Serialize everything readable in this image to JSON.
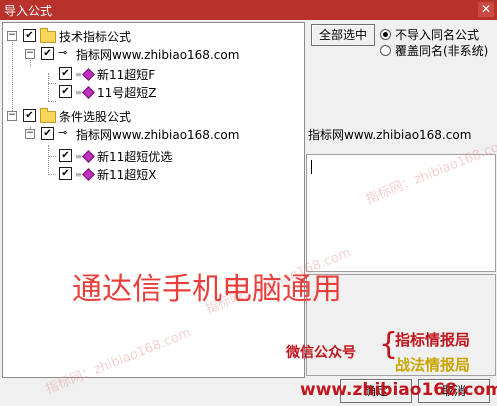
{
  "window": {
    "title": "导入公式",
    "close_glyph": "✕"
  },
  "tree": {
    "groups": [
      {
        "label": "技术指标公式",
        "source": "指标网www.zhibiao168.com",
        "items": [
          "新11超短F",
          "11号超短Z"
        ]
      },
      {
        "label": "条件选股公式",
        "source": "指标网www.zhibiao168.com",
        "items": [
          "新11超短优选",
          "新11超短X"
        ]
      }
    ]
  },
  "buttons": {
    "select_all": "全部选中",
    "ok": "确定",
    "cancel": "取消"
  },
  "options": {
    "skip_same": "不导入同名公式",
    "overwrite_same": "覆盖同名(非系统)",
    "selected": "skip_same"
  },
  "info": {
    "source_text": "指标网www.zhibiao168.com",
    "description": ""
  },
  "overlay": {
    "banner": "通达信手机电脑通用",
    "wechat_label": "微信公众号",
    "account1": "指标情报局",
    "account2": "战法情报局",
    "site": "www.zhibiao168.com",
    "watermark": "指标网：zhibiao168.com"
  },
  "colors": {
    "titlebar": "#b8312b",
    "banner": "#e8413d",
    "promo_red": "#c0161d",
    "promo_gold": "#c9a400"
  }
}
